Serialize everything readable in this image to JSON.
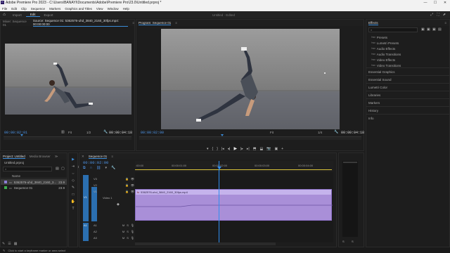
{
  "window": {
    "title": "Adobe Premiere Pro 2023 - C:\\Users\\BANAYI\\Documents\\Adobe\\Premiere Pro\\23.0\\Untitled.prproj *",
    "minimize": "—",
    "maximize": "☐",
    "close": "✕"
  },
  "menu": [
    "File",
    "Edit",
    "Clip",
    "Sequence",
    "Markers",
    "Graphics and Titles",
    "View",
    "Window",
    "Help"
  ],
  "workspace": {
    "home_icon": "⌂",
    "tabs": [
      "Import",
      "Edit",
      "Export"
    ],
    "active": "Edit",
    "center_title": "Untitled",
    "center_sub": "Edited",
    "right_icons": [
      "⤢",
      "⛶",
      "⬈"
    ]
  },
  "source": {
    "tabs": [
      "Mixer: Sequence 01",
      "Source: Sequence 01: 5362576-uhd_3840_2160_30fps.mp4: 00:00:00:00",
      "≡"
    ],
    "tc_in": "00:00:02:01",
    "fit": "Fit",
    "fraction": "1/2",
    "tc_dur": "00:00:04:18",
    "controls": [
      "▾",
      "{",
      "}",
      "|◂",
      "◂|",
      "▶",
      "|▸",
      "▸|",
      "⬒",
      "⬓",
      "⧉",
      "+"
    ]
  },
  "program": {
    "tabs": [
      "Program: Sequence 01",
      "≡"
    ],
    "tc_in": "00:00:02:00",
    "fit": "Fit",
    "fraction": "1/4",
    "tc_dur": "00:00:04:18",
    "controls": [
      "▾",
      "{",
      "}",
      "|◂",
      "◂|",
      "▶",
      "|▸",
      "▸|",
      "⬒",
      "⬓",
      "📷",
      "▣",
      "+"
    ]
  },
  "effects": {
    "title": "Effects",
    "menu": "≡",
    "search_placeholder": "",
    "folders": [
      "Presets",
      "Lumetri Presets",
      "Audio Effects",
      "Audio Transitions",
      "Video Effects",
      "Video Transitions"
    ],
    "sections": [
      "Essential Graphics",
      "Essential Sound",
      "Lumetri Color",
      "Libraries",
      "Markers",
      "History",
      "Info"
    ]
  },
  "project": {
    "tabs": [
      "Project: Untitled",
      "Media Browser",
      "≫"
    ],
    "file": "Untitled.prproj",
    "name_header": "Name",
    "items": [
      {
        "name": "5362576-uhd_3840_2160_3...",
        "value": "23.9",
        "color": "#8d7fd6"
      },
      {
        "name": "Sequence 01",
        "value": "23.9",
        "color": "#3fae4f"
      }
    ]
  },
  "sequence": {
    "tab": "Sequence 01",
    "menu": "≡",
    "close": "✕",
    "timecode": "00:00:02:00",
    "ruler_ticks": [
      ":00:00",
      "00:00:01:00",
      "00:00:02:00",
      "00:00:03:00",
      "00:00:04:00"
    ],
    "video_tracks": [
      "V3",
      "V2",
      "V1"
    ],
    "video_label": "Video 1",
    "audio_tracks": [
      "A1",
      "A2",
      "A3"
    ],
    "audio_flags": [
      "M",
      "S"
    ],
    "clip_name": "5362576-uhd_3840_2160_30fps.mp4",
    "fx": "fx",
    "v1_src": "V1",
    "a1_src": "A1",
    "meter_labels": [
      "S",
      "S"
    ]
  },
  "tools": [
    "▶",
    "⇥",
    "⇔",
    "◇",
    "✎",
    "□",
    "✋",
    "T"
  ],
  "status": {
    "icon": "✎",
    "text": "Click to start a keyframe marker or area select"
  },
  "colors": {
    "accent": "#3b8cd8",
    "clip": "#a98fd8",
    "clip_header": "#c5b3ec",
    "playhead": "#2f8ef0"
  }
}
